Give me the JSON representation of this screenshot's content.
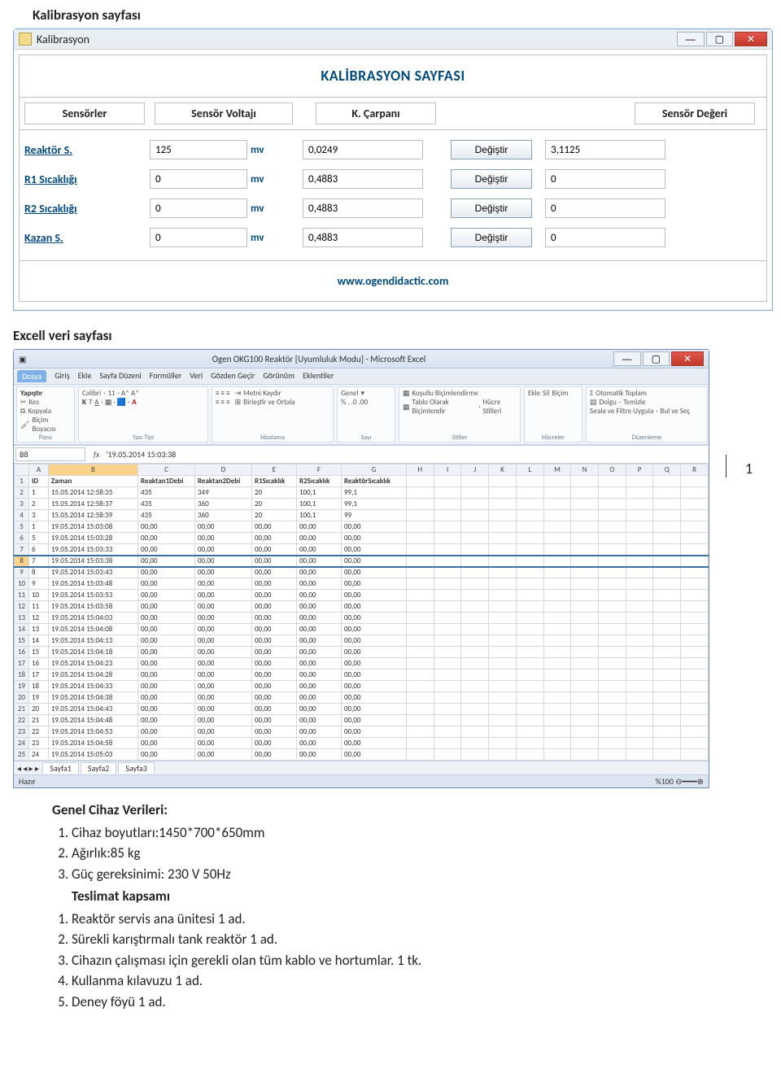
{
  "headings": {
    "kalibrasyon": "Kalibrasyon sayfası",
    "excel": "Excell veri sayfası"
  },
  "pageNumber": "1",
  "win1": {
    "title": "Kalibrasyon",
    "banner": "KALİBRASYON SAYFASI",
    "cols": {
      "c1": "Sensörler",
      "c2": "Sensör Voltajı",
      "c3": "K. Çarpanı",
      "c4": "Sensör Değeri"
    },
    "unit": "mv",
    "change": "Değiştir",
    "rows": [
      {
        "label": "Reaktör S.",
        "volt": "125",
        "carp": "0,0249",
        "deg": "3,1125"
      },
      {
        "label": "R1 Sıcaklığı",
        "volt": "0",
        "carp": "0,4883",
        "deg": "0"
      },
      {
        "label": "R2 Sıcaklığı",
        "volt": "0",
        "carp": "0,4883",
        "deg": "0"
      },
      {
        "label": "Kazan S.",
        "volt": "0",
        "carp": "0,4883",
        "deg": "0"
      }
    ],
    "url": "www.ogendidactic.com"
  },
  "win2": {
    "title": "Ogen OKG100 Reaktör  [Uyumluluk Modu]  -  Microsoft Excel",
    "tabs": [
      "Dosya",
      "Giriş",
      "Ekle",
      "Sayfa Düzeni",
      "Formüller",
      "Veri",
      "Gözden Geçir",
      "Görünüm",
      "Eklentiler"
    ],
    "ribbonGroups": [
      "Pano",
      "Yazı Tipi",
      "Hizalama",
      "Sayı",
      "Stiller",
      "Hücreler",
      "Düzenleme"
    ],
    "clipboard": {
      "paste": "Yapıştır",
      "cut": "Kes",
      "copy": "Kopyala",
      "fmt": "Biçim Boyacısı"
    },
    "font": {
      "name": "Calibri",
      "size": "11"
    },
    "align": {
      "wrap": "Metni Kaydır",
      "merge": "Birleştir ve Ortala"
    },
    "number": {
      "fmt": "Genel"
    },
    "styles": {
      "cond": "Koşullu Biçimlendirme",
      "tbl": "Tablo Olarak Biçimlendir",
      "cell": "Hücre Stilleri"
    },
    "cells": {
      "ins": "Ekle",
      "del": "Sil",
      "fmt": "Biçim"
    },
    "editing": {
      "sum": "Otomatik Toplam",
      "fill": "Dolgu",
      "clear": "Temizle",
      "sort": "Sırala ve Filtre Uygula",
      "find": "Bul ve Seç"
    },
    "nameBox": "B8",
    "fxValue": "'19.05.2014 15:03:38",
    "colLetters": [
      "A",
      "B",
      "C",
      "D",
      "E",
      "F",
      "G",
      "H",
      "I",
      "J",
      "K",
      "L",
      "M",
      "N",
      "O",
      "P",
      "Q",
      "R"
    ],
    "headerRow": [
      "ID",
      "Zaman",
      "Reaktan1Debi",
      "Reaktan2Debi",
      "R1Sıcaklık",
      "R2Sıcaklık",
      "ReaktörSıcaklık"
    ],
    "rows": [
      [
        "1",
        "15.05.2014 12:58:35",
        "435",
        "349",
        "20",
        "100,1",
        "99,1"
      ],
      [
        "2",
        "15.05.2014 12:58:37",
        "435",
        "360",
        "20",
        "100,1",
        "99,1"
      ],
      [
        "3",
        "15.05.2014 12:58:39",
        "435",
        "360",
        "20",
        "100,1",
        "99"
      ],
      [
        "1",
        "19.05.2014 15:03:08",
        "00,00",
        "00,00",
        "00,00",
        "00,00",
        "00,00"
      ],
      [
        "5",
        "19.05.2014 15:03:28",
        "00,00",
        "00,00",
        "00,00",
        "00,00",
        "00,00"
      ],
      [
        "6",
        "19.05.2014 15:03:33",
        "00,00",
        "00,00",
        "00,00",
        "00,00",
        "00,00"
      ],
      [
        "7",
        "19.05.2014 15:03:38",
        "00,00",
        "00,00",
        "00,00",
        "00,00",
        "00,00"
      ],
      [
        "8",
        "19.05.2014 15:03:43",
        "00,00",
        "00,00",
        "00,00",
        "00,00",
        "00,00"
      ],
      [
        "9",
        "19.05.2014 15:03:48",
        "00,00",
        "00,00",
        "00,00",
        "00,00",
        "00,00"
      ],
      [
        "10",
        "19.05.2014 15:03:53",
        "00,00",
        "00,00",
        "00,00",
        "00,00",
        "00,00"
      ],
      [
        "11",
        "19.05.2014 15:03:58",
        "00,00",
        "00,00",
        "00,00",
        "00,00",
        "00,00"
      ],
      [
        "12",
        "19.05.2014 15:04:03",
        "00,00",
        "00,00",
        "00,00",
        "00,00",
        "00,00"
      ],
      [
        "13",
        "19.05.2014 15:04:08",
        "00,00",
        "00,00",
        "00,00",
        "00,00",
        "00,00"
      ],
      [
        "14",
        "19.05.2014 15:04:13",
        "00,00",
        "00,00",
        "00,00",
        "00,00",
        "00,00"
      ],
      [
        "15",
        "19.05.2014 15:04:18",
        "00,00",
        "00,00",
        "00,00",
        "00,00",
        "00,00"
      ],
      [
        "16",
        "19.05.2014 15:04:23",
        "00,00",
        "00,00",
        "00,00",
        "00,00",
        "00,00"
      ],
      [
        "17",
        "19.05.2014 15:04:28",
        "00,00",
        "00,00",
        "00,00",
        "00,00",
        "00,00"
      ],
      [
        "18",
        "19.05.2014 15:04:33",
        "00,00",
        "00,00",
        "00,00",
        "00,00",
        "00,00"
      ],
      [
        "19",
        "19.05.2014 15:04:38",
        "00,00",
        "00,00",
        "00,00",
        "00,00",
        "00,00"
      ],
      [
        "20",
        "19.05.2014 15:04:43",
        "00,00",
        "00,00",
        "00,00",
        "00,00",
        "00,00"
      ],
      [
        "21",
        "19.05.2014 15:04:48",
        "00,00",
        "00,00",
        "00,00",
        "00,00",
        "00,00"
      ],
      [
        "22",
        "19.05.2014 15:04:53",
        "00,00",
        "00,00",
        "00,00",
        "00,00",
        "00,00"
      ],
      [
        "23",
        "19.05.2014 15:04:58",
        "00,00",
        "00,00",
        "00,00",
        "00,00",
        "00,00"
      ],
      [
        "24",
        "19.05.2014 15:05:03",
        "00,00",
        "00,00",
        "00,00",
        "00,00",
        "00,00"
      ]
    ],
    "sheets": [
      "Sayfa1",
      "Sayfa2",
      "Sayfa3"
    ],
    "status": {
      "ready": "Hazır",
      "zoom": "%100"
    }
  },
  "content": {
    "h1": "Genel Cihaz Verileri:",
    "l1": "Cihaz boyutları:1450*700*650mm",
    "l2": "Ağırlık:85 kg",
    "l3": "Güç gereksinimi: 230 V 50Hz",
    "h2": "Teslimat kapsamı",
    "l4": "Reaktör servis ana ünitesi 1 ad.",
    "l5": "Sürekli karıştırmalı tank reaktör 1 ad.",
    "l6": "Cihazın çalışması için gerekli olan tüm kablo ve hortumlar. 1 tk.",
    "l7": "Kullanma kılavuzu 1 ad.",
    "l8": "Deney föyü 1 ad."
  }
}
